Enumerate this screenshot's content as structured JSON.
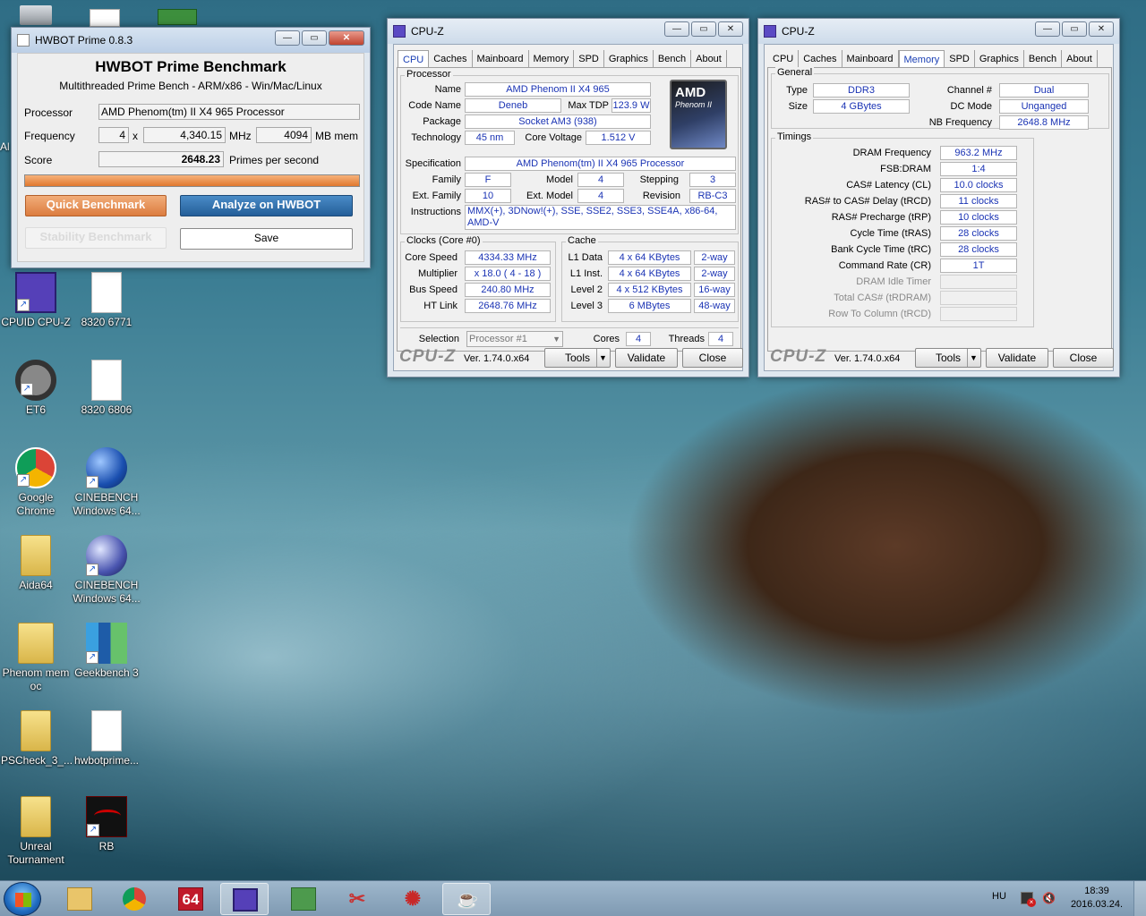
{
  "desktop": {
    "icons": [
      {
        "label": "CPUID CPU-Z",
        "icon": "cpuz-icon"
      },
      {
        "label": "8320 6771",
        "icon": "file-icon"
      },
      {
        "label": "ET6",
        "icon": "steering-wheel-icon"
      },
      {
        "label": "8320 6806",
        "icon": "file-icon"
      },
      {
        "label": "Google Chrome",
        "icon": "chrome-icon"
      },
      {
        "label": "CINEBENCH Windows 64...",
        "icon": "cinebench-icon"
      },
      {
        "label": "Aida64",
        "icon": "folder-icon"
      },
      {
        "label": "CINEBENCH Windows 64...",
        "icon": "cinebench-icon"
      },
      {
        "label": "Phenom mem oc",
        "icon": "folder-icon"
      },
      {
        "label": "Geekbench 3",
        "icon": "geekbench-icon"
      },
      {
        "label": "PSCheck_3_...",
        "icon": "folder-icon"
      },
      {
        "label": "hwbotprime...",
        "icon": "java-file-icon"
      },
      {
        "label": "Unreal Tournament",
        "icon": "folder-icon"
      },
      {
        "label": "RB",
        "icon": "rog-icon"
      }
    ],
    "left_edge_text": "Al"
  },
  "hwbot": {
    "title": "HWBOT Prime 0.8.3",
    "heading": "HWBOT Prime Benchmark",
    "subheading": "Multithreaded Prime Bench - ARM/x86 - Win/Mac/Linux",
    "processor_label": "Processor",
    "processor": "AMD Phenom(tm) II X4 965 Processor",
    "frequency_label": "Frequency",
    "cores": "4",
    "times": "x",
    "frequency": "4,340.15",
    "mhz": "MHz",
    "mem": "4094",
    "mem_unit": "MB mem",
    "score_label": "Score",
    "score": "2648.23",
    "score_unit": "Primes per second",
    "progress": 1.0,
    "quick_btn": "Quick Benchmark",
    "analyze_btn": "Analyze on HWBOT",
    "stability_btn": "Stability Benchmark",
    "save_btn": "Save"
  },
  "cpuz_cpu": {
    "title": "CPU-Z",
    "tabs": [
      "CPU",
      "Caches",
      "Mainboard",
      "Memory",
      "SPD",
      "Graphics",
      "Bench",
      "About"
    ],
    "active_tab": "CPU",
    "processor_group": "Processor",
    "name_l": "Name",
    "name": "AMD Phenom II X4 965",
    "codename_l": "Code Name",
    "codename": "Deneb",
    "maxtdp_l": "Max TDP",
    "maxtdp": "123.9 W",
    "package_l": "Package",
    "package": "Socket AM3 (938)",
    "tech_l": "Technology",
    "tech": "45 nm",
    "vcore_l": "Core Voltage",
    "vcore": "1.512 V",
    "spec_l": "Specification",
    "spec": "AMD Phenom(tm) II X4 965 Processor",
    "family_l": "Family",
    "family": "F",
    "model_l": "Model",
    "model": "4",
    "stepping_l": "Stepping",
    "stepping": "3",
    "extfam_l": "Ext. Family",
    "extfam": "10",
    "extmod_l": "Ext. Model",
    "extmod": "4",
    "rev_l": "Revision",
    "rev": "RB-C3",
    "instr_l": "Instructions",
    "instr1": "MMX(+), 3DNow!(+), SSE, SSE2, SSE3, SSE4A, x86-64,",
    "instr2": "AMD-V",
    "logo_brand": "AMD",
    "logo_sub": "Phenom II",
    "clocks_group": "Clocks (Core #0)",
    "cs_l": "Core Speed",
    "cs": "4334.33 MHz",
    "mult_l": "Multiplier",
    "mult": "x 18.0 ( 4 - 18 )",
    "bus_l": "Bus Speed",
    "bus": "240.80 MHz",
    "ht_l": "HT Link",
    "ht": "2648.76 MHz",
    "cache_group": "Cache",
    "l1d_l": "L1 Data",
    "l1d": "4 x 64 KBytes",
    "l1d_w": "2-way",
    "l1i_l": "L1 Inst.",
    "l1i": "4 x 64 KBytes",
    "l1i_w": "2-way",
    "l2_l": "Level 2",
    "l2": "4 x 512 KBytes",
    "l2_w": "16-way",
    "l3_l": "Level 3",
    "l3": "6 MBytes",
    "l3_w": "48-way",
    "sel_l": "Selection",
    "sel": "Processor #1",
    "cores_l": "Cores",
    "cores": "4",
    "threads_l": "Threads",
    "threads": "4",
    "logo": "CPU-Z",
    "version": "Ver. 1.74.0.x64",
    "tools": "Tools",
    "validate": "Validate",
    "close": "Close"
  },
  "cpuz_mem": {
    "title": "CPU-Z",
    "active_tab": "Memory",
    "general_group": "General",
    "type_l": "Type",
    "type": "DDR3",
    "channel_l": "Channel #",
    "channel": "Dual",
    "size_l": "Size",
    "size": "4 GBytes",
    "dcmode_l": "DC Mode",
    "dcmode": "Unganged",
    "nbfreq_l": "NB Frequency",
    "nbfreq": "2648.8 MHz",
    "timings_group": "Timings",
    "timings": [
      {
        "label": "DRAM Frequency",
        "value": "963.2 MHz",
        "dim": false
      },
      {
        "label": "FSB:DRAM",
        "value": "1:4",
        "dim": false
      },
      {
        "label": "CAS# Latency (CL)",
        "value": "10.0 clocks",
        "dim": false
      },
      {
        "label": "RAS# to CAS# Delay (tRCD)",
        "value": "11 clocks",
        "dim": false
      },
      {
        "label": "RAS# Precharge (tRP)",
        "value": "10 clocks",
        "dim": false
      },
      {
        "label": "Cycle Time (tRAS)",
        "value": "28 clocks",
        "dim": false
      },
      {
        "label": "Bank Cycle Time (tRC)",
        "value": "28 clocks",
        "dim": false
      },
      {
        "label": "Command Rate (CR)",
        "value": "1T",
        "dim": false
      },
      {
        "label": "DRAM Idle Timer",
        "value": "",
        "dim": true
      },
      {
        "label": "Total CAS# (tRDRAM)",
        "value": "",
        "dim": true
      },
      {
        "label": "Row To Column (tRCD)",
        "value": "",
        "dim": true
      }
    ]
  },
  "taskbar": {
    "items": [
      "windows-explorer-icon",
      "chrome-icon",
      "aida64-icon",
      "cpuz-icon",
      "network-icon",
      "snipping-icon",
      "atom-icon",
      "java-icon"
    ],
    "aida_text": "64",
    "lang": "HU",
    "time": "18:39",
    "date": "2016.03.24."
  },
  "colors": {
    "accent_orange": "#f0a060",
    "hwbot_blue": "#2f6ea4",
    "value_blue": "#1a33b4"
  }
}
